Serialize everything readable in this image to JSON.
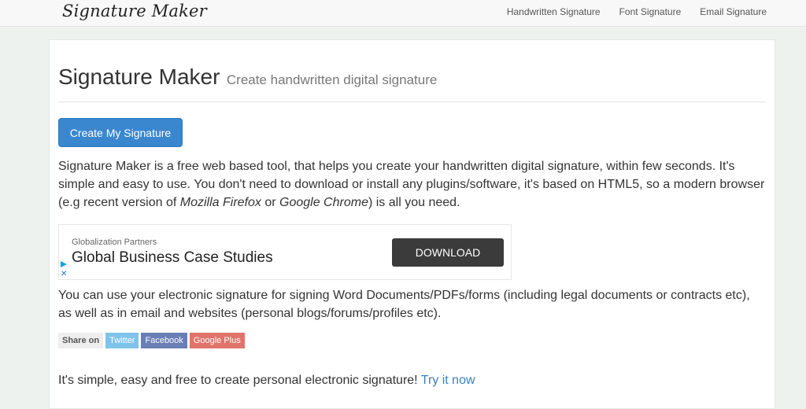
{
  "navbar": {
    "brand": "Signature Maker",
    "links": [
      "Handwritten Signature",
      "Font Signature",
      "Email Signature"
    ]
  },
  "header": {
    "title": "Signature Maker",
    "subtitle": "Create handwritten digital signature"
  },
  "create_button": "Create My Signature",
  "intro": {
    "text_1": "Signature Maker is a free web based tool, that helps you create your handwritten digital signature, within few seconds. It's simple and easy to use. You don't need to download or install any plugins/software, it's based on HTML5, so a modern browser (e.g recent version of ",
    "browser_1": "Mozilla Firefox",
    "text_2": " or ",
    "browser_2": "Google Chrome",
    "text_3": ") is all you need."
  },
  "ad": {
    "source": "Globalization Partners",
    "title": "Global Business Case Studies",
    "button": "DOWNLOAD",
    "close": "✕"
  },
  "usage_text": "You can use your electronic signature for signing Word Documents/PDFs/forms (including legal documents or contracts etc), as well as in email and websites (personal blogs/forums/profiles etc).",
  "share": {
    "label": "Share on",
    "twitter": "Twitter",
    "facebook": "Facebook",
    "google_plus": "Google Plus"
  },
  "cta": {
    "text": "It's simple, easy and free to create personal electronic signature! ",
    "link": "Try it now"
  },
  "colors": {
    "primary_button": "#3a87d0",
    "link": "#3a7fc1",
    "twitter": "#7fc3ea",
    "facebook": "#6a7fb5",
    "google_plus": "#e0746a"
  }
}
